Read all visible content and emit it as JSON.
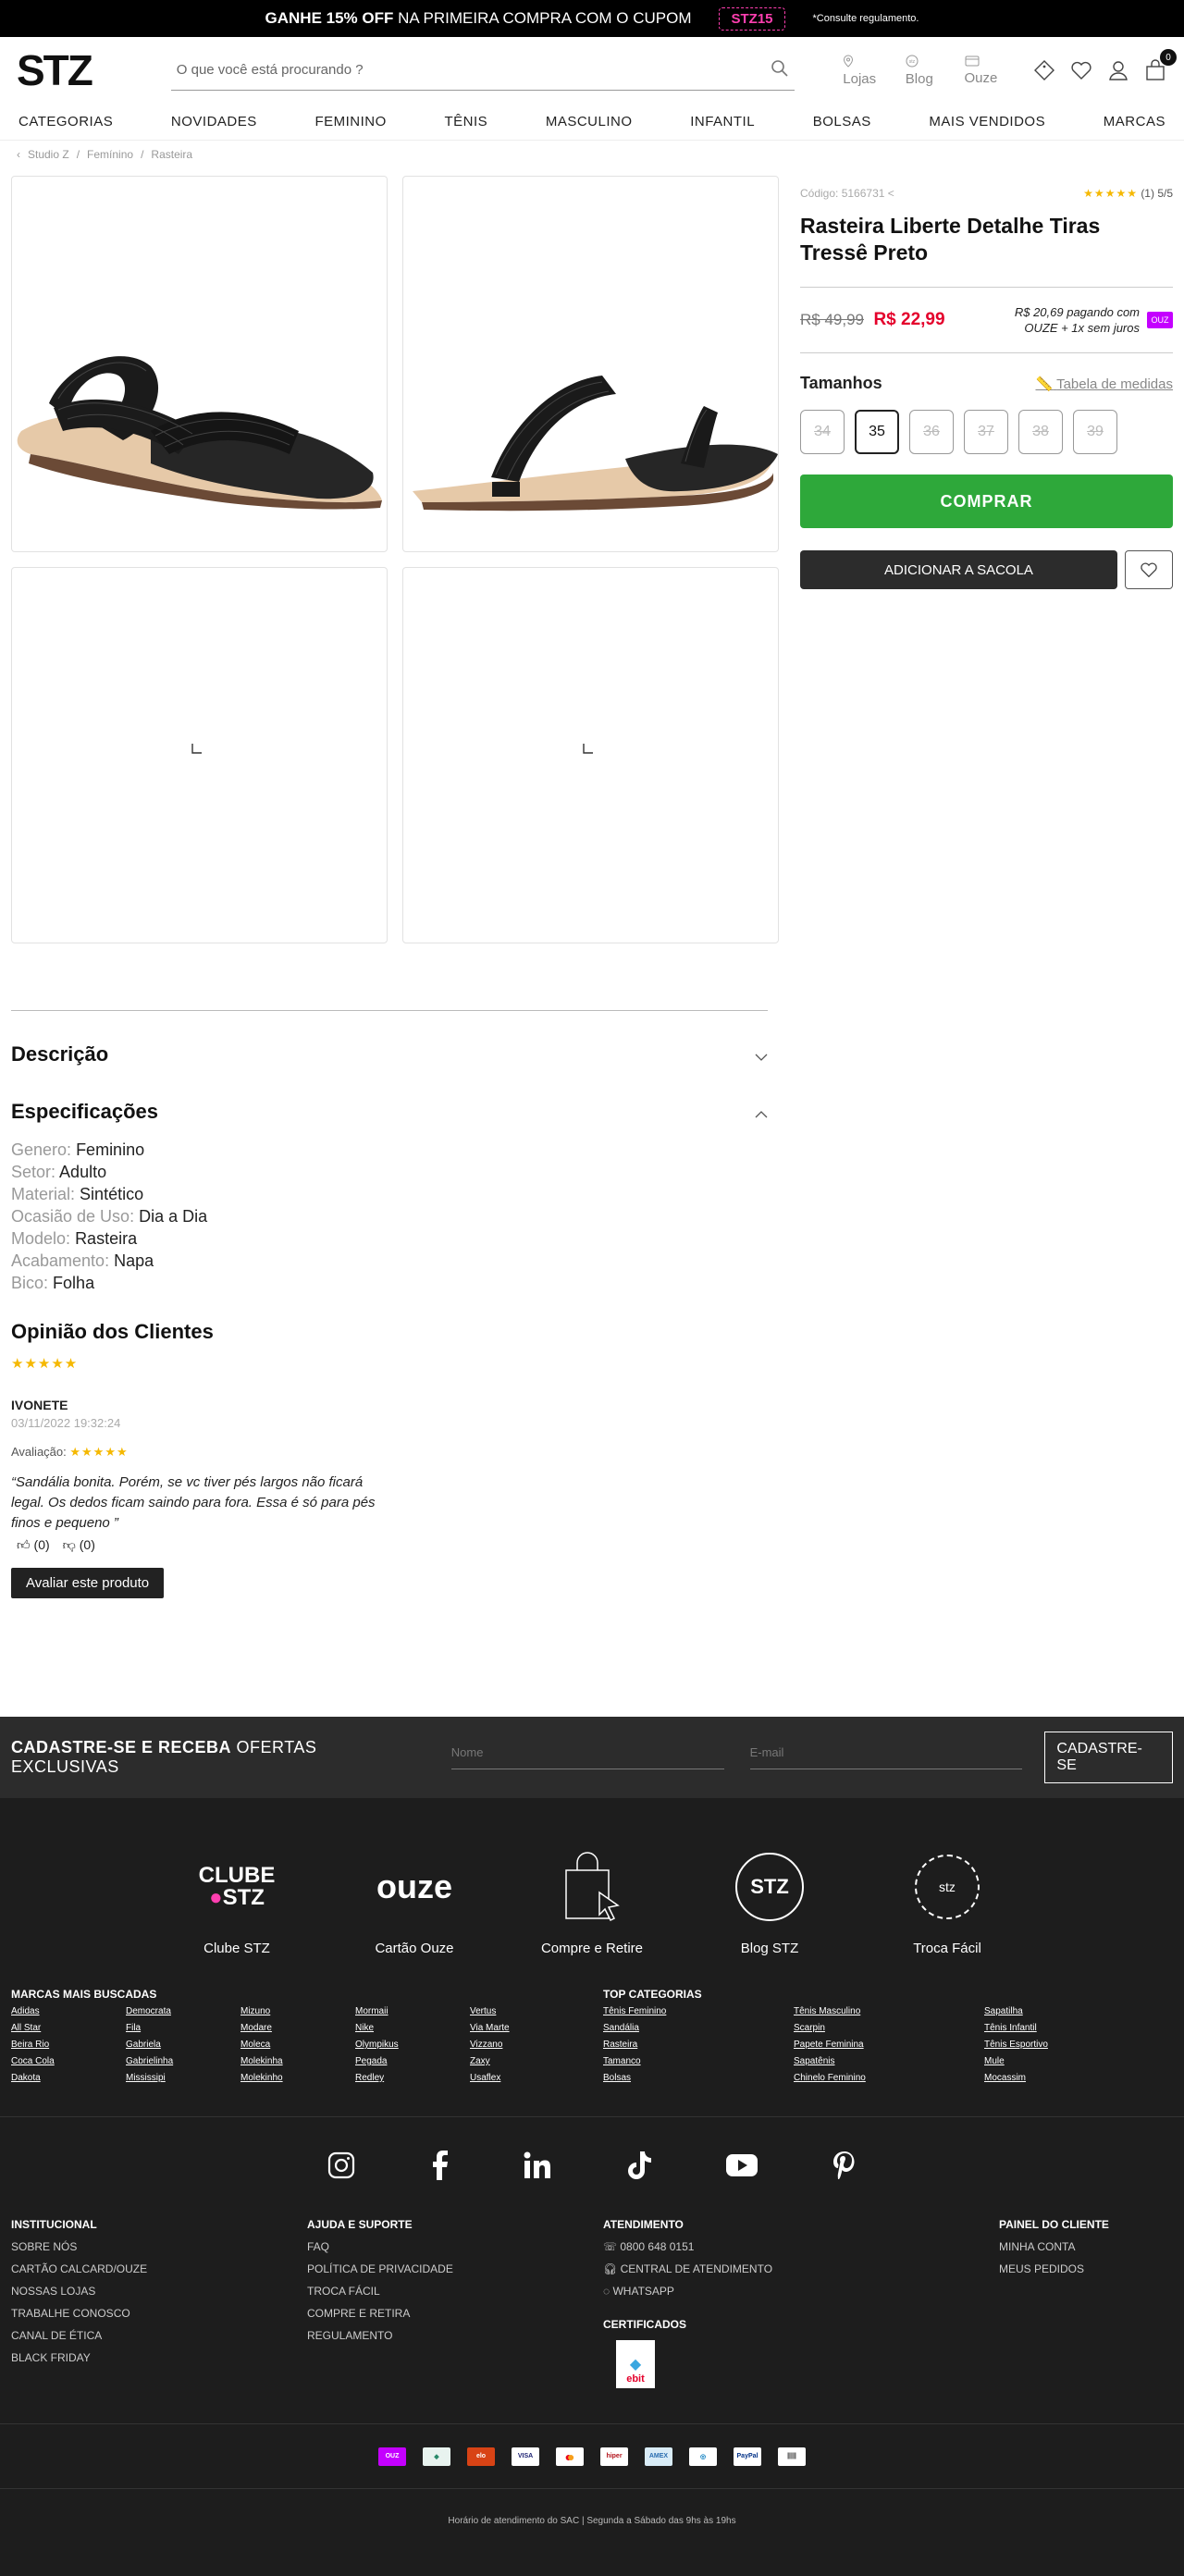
{
  "topbar": {
    "bold": "GANHE 15% OFF",
    "rest": "NA PRIMEIRA COMPRA COM O CUPOM",
    "coupon": "STZ15",
    "note": "*Consulte regulamento."
  },
  "header": {
    "logo": "STZ",
    "search_placeholder": "O que você está procurando ?",
    "links": [
      "Lojas",
      "Blog",
      "Ouze"
    ],
    "cart_count": "0"
  },
  "nav": [
    "CATEGORIAS",
    "NOVIDADES",
    "FEMININO",
    "TÊNIS",
    "MASCULINO",
    "INFANTIL",
    "BOLSAS",
    "MAIS VENDIDOS",
    "MARCAS"
  ],
  "breadcrumb": [
    "Studio Z",
    "Femínino",
    "Rasteira"
  ],
  "product": {
    "code": "Código: 5166731",
    "rating_stars": "★★★★★",
    "rating_text": "(1) 5/5",
    "title": "Rasteira Liberte Detalhe Tiras Tressê Preto",
    "old_price": "R$ 49,99",
    "price": "R$ 22,99",
    "ouze_line1": "R$ 20,69 pagando com",
    "ouze_line2": "OUZE + 1x sem juros",
    "ouze_badge": "OUZ",
    "sizes_title": "Tamanhos",
    "measure_link": "Tabela de medidas",
    "sizes": [
      {
        "label": "34",
        "available": false
      },
      {
        "label": "35",
        "available": true
      },
      {
        "label": "36",
        "available": false
      },
      {
        "label": "37",
        "available": false
      },
      {
        "label": "38",
        "available": false
      },
      {
        "label": "39",
        "available": false
      }
    ],
    "buy": "COMPRAR",
    "add_to_bag": "ADICIONAR A SACOLA"
  },
  "description": {
    "title": "Descrição"
  },
  "specifications": {
    "title": "Especificações",
    "items": [
      {
        "key": "Genero:",
        "value": "Feminino"
      },
      {
        "key": "Setor:",
        "value": "Adulto"
      },
      {
        "key": "Material:",
        "value": "Sintético"
      },
      {
        "key": "Ocasião de Uso:",
        "value": "Dia a Dia"
      },
      {
        "key": "Modelo:",
        "value": "Rasteira"
      },
      {
        "key": "Acabamento:",
        "value": "Napa"
      },
      {
        "key": "Bico:",
        "value": "Folha"
      }
    ]
  },
  "reviews": {
    "title": "Opinião dos Clientes",
    "stars": "★★★★★",
    "name": "IVONETE",
    "date": "03/11/2022 19:32:24",
    "rating_label": "Avaliação:",
    "text": "“Sandália bonita. Porém, se vc tiver pés largos não ficará legal. Os dedos ficam saindo para fora. Essa é só para pés finos e pequeno ”",
    "likes": "(0)",
    "dislikes": "(0)",
    "button": "Avaliar este produto"
  },
  "newsletter": {
    "title_bold": "CADASTRE-SE E RECEBA",
    "title_rest": "OFERTAS EXCLUSIVAS",
    "name_placeholder": "Nome",
    "email_placeholder": "E-mail",
    "button": "CADASTRE-SE"
  },
  "services": [
    {
      "logo_text": "CLUBE",
      "logo_sub": "STZ",
      "label": "Clube STZ"
    },
    {
      "logo_text": "ouze",
      "label": "Cartão Ouze"
    },
    {
      "label": "Compre e Retire"
    },
    {
      "logo_text": "STZ",
      "label": "Blog STZ"
    },
    {
      "logo_text": "stz",
      "label": "Troca Fácil"
    }
  ],
  "brands": {
    "title": "MARCAS MAIS BUSCADAS",
    "columns": [
      [
        "Adidas",
        "All Star",
        "Beira Rio",
        "Coca Cola",
        "Dakota"
      ],
      [
        "Democrata",
        "Fila",
        "Gabriela",
        "Gabrielinha",
        "Mississipi"
      ],
      [
        "Mizuno",
        "Modare",
        "Moleca",
        "Molekinha",
        "Molekinho"
      ],
      [
        "Mormaii",
        "Nike",
        "Olympikus",
        "Pegada",
        "Redley"
      ],
      [
        "Vertus",
        "Via Marte",
        "Vizzano",
        "Zaxy",
        "Usaflex"
      ]
    ]
  },
  "top_categories": {
    "title": "TOP CATEGORIAS",
    "columns": [
      [
        "Tênis Feminino",
        "Sandália",
        "Rasteira",
        "Tamanco",
        "Bolsas"
      ],
      [
        "Tênis Masculino",
        "Scarpin",
        "Papete Feminina",
        "Sapatênis",
        "Chinelo Feminino"
      ],
      [
        "Sapatilha",
        "Tênis Infantil",
        "Tênis Esportivo",
        "Mule",
        "Mocassim"
      ]
    ]
  },
  "institucional": {
    "title": "INSTITUCIONAL",
    "items": [
      "SOBRE NÓS",
      "CARTÃO CALCARD/OUZE",
      "NOSSAS LOJAS",
      "TRABALHE CONOSCO",
      "CANAL DE ÉTICA",
      "BLACK FRIDAY"
    ]
  },
  "ajuda": {
    "title": "AJUDA E SUPORTE",
    "items": [
      "FAQ",
      "POLÍTICA DE PRIVACIDADE",
      "TROCA FÁCIL",
      "COMPRE E RETIRA",
      "REGULAMENTO"
    ]
  },
  "atendimento": {
    "title": "ATENDIMENTO",
    "items": [
      "0800 648 0151",
      "CENTRAL DE ATENDIMENTO",
      "WHATSAPP"
    ],
    "cert_title": "CERTIFICADOS",
    "ebit": "ebit"
  },
  "painel": {
    "title": "PAINEL DO CLIENTE",
    "items": [
      "MINHA CONTA",
      "MEUS PEDIDOS"
    ]
  },
  "payments": [
    "OUZ",
    "Boleto",
    "Elo",
    "VISA",
    "MC",
    "Hiper",
    "Amex",
    "Diners",
    "PayPal",
    "Barcode"
  ],
  "sac": "Horário de atendimento do SAC | Segunda a Sábado das 9hs às 19hs",
  "colors": {
    "buy": "#2ea83a",
    "price": "#e4002b",
    "stars": "#f5b800",
    "coupon": "#ff3fb0",
    "footer": "#1d1d1d",
    "newsletter": "#2c2c2c"
  }
}
